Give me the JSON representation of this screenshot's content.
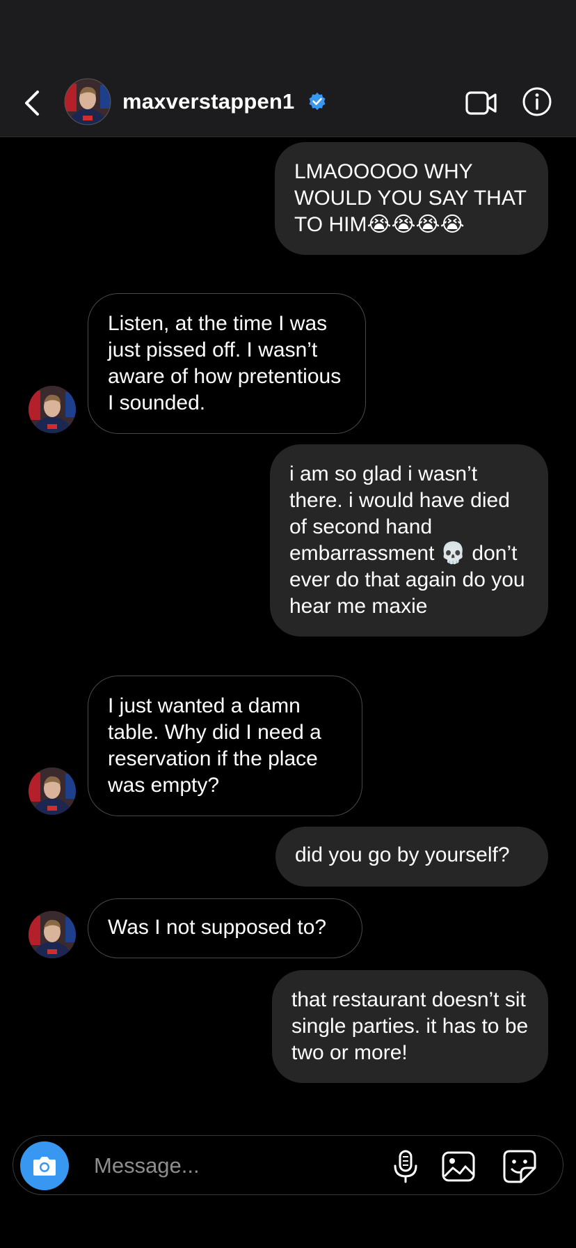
{
  "header": {
    "username": "maxverstappen1",
    "verified": true,
    "accent_color": "#3897f0"
  },
  "icons": {
    "back": "chevron-left-icon",
    "video": "video-call-icon",
    "info": "info-icon",
    "camera": "camera-icon",
    "mic": "microphone-icon",
    "gallery": "gallery-icon",
    "sticker": "sticker-icon"
  },
  "messages": [
    {
      "side": "sent",
      "text": "LMAOOOOO WHY WOULD YOU SAY THAT TO HIM😭😭😭😭"
    },
    {
      "side": "received",
      "text": "Listen, at the time I was just pissed off. I wasn’t aware of how pretentious I sounded."
    },
    {
      "side": "sent",
      "text": "i am so glad i wasn’t there. i would have died of second hand embarrassment 💀 don’t ever do that again do you hear me maxie"
    },
    {
      "side": "received",
      "text": "I just wanted a damn table. Why did I need a reservation if the place was empty?"
    },
    {
      "side": "sent",
      "text": "did you go by yourself?"
    },
    {
      "side": "received",
      "text": "Was I not supposed to?"
    },
    {
      "side": "sent",
      "text": "that restaurant doesn’t sit single parties. it has to be two or more!"
    }
  ],
  "composer": {
    "placeholder": "Message..."
  }
}
